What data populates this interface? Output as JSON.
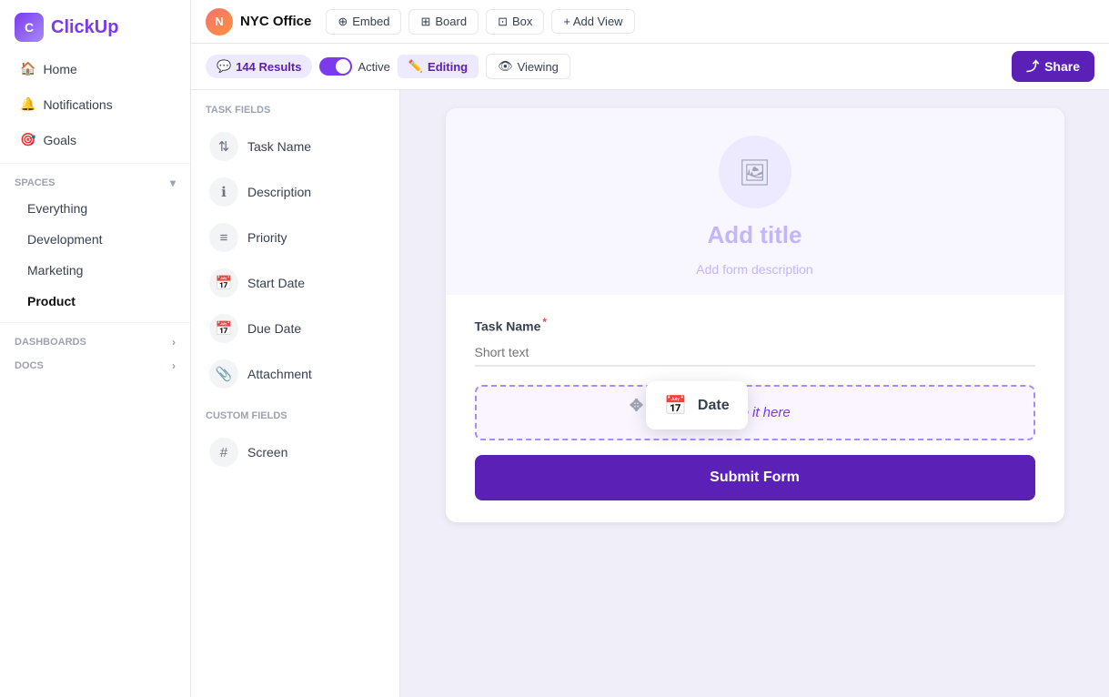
{
  "app": {
    "logo_text": "C",
    "logo_full": "ClickUp"
  },
  "sidebar": {
    "nav_items": [
      {
        "id": "home",
        "label": "Home"
      },
      {
        "id": "notifications",
        "label": "Notifications"
      },
      {
        "id": "goals",
        "label": "Goals"
      }
    ],
    "spaces_label": "Spaces",
    "spaces_items": [
      {
        "id": "everything",
        "label": "Everything"
      },
      {
        "id": "development",
        "label": "Development"
      },
      {
        "id": "marketing",
        "label": "Marketing"
      },
      {
        "id": "product",
        "label": "Product"
      }
    ],
    "dashboards_label": "Dashboards",
    "docs_label": "Docs"
  },
  "topbar": {
    "workspace_icon": "🏢",
    "workspace_name": "NYC Office",
    "embed_label": "Embed",
    "board_label": "Board",
    "box_label": "Box",
    "add_view_label": "+ Add View"
  },
  "toolbar": {
    "results_count": "144 Results",
    "active_label": "Active",
    "editing_label": "Editing",
    "viewing_label": "Viewing",
    "share_label": "Share"
  },
  "fields_panel": {
    "task_fields_title": "TASK FIELDS",
    "task_fields": [
      {
        "id": "task-name",
        "label": "Task Name",
        "icon": "⇅"
      },
      {
        "id": "description",
        "label": "Description",
        "icon": "ℹ"
      },
      {
        "id": "priority",
        "label": "Priority",
        "icon": "≡"
      },
      {
        "id": "start-date",
        "label": "Start Date",
        "icon": "📅"
      },
      {
        "id": "due-date",
        "label": "Due Date",
        "icon": "📅"
      },
      {
        "id": "attachment",
        "label": "Attachment",
        "icon": "📎"
      }
    ],
    "custom_fields_title": "CUSTOM FIELDS",
    "custom_fields": [
      {
        "id": "screen",
        "label": "Screen",
        "icon": "#"
      }
    ]
  },
  "form": {
    "avatar_icon": "🖼",
    "title_placeholder": "Add title",
    "desc_placeholder": "Add form description",
    "task_name_label": "Task Name",
    "task_name_required": "*",
    "task_name_placeholder": "Short text",
    "drop_it_here": "Drop it here",
    "submit_label": "Submit Form"
  },
  "drag_tooltip": {
    "icon": "📅",
    "label": "Date",
    "handle_icon": "✥"
  }
}
